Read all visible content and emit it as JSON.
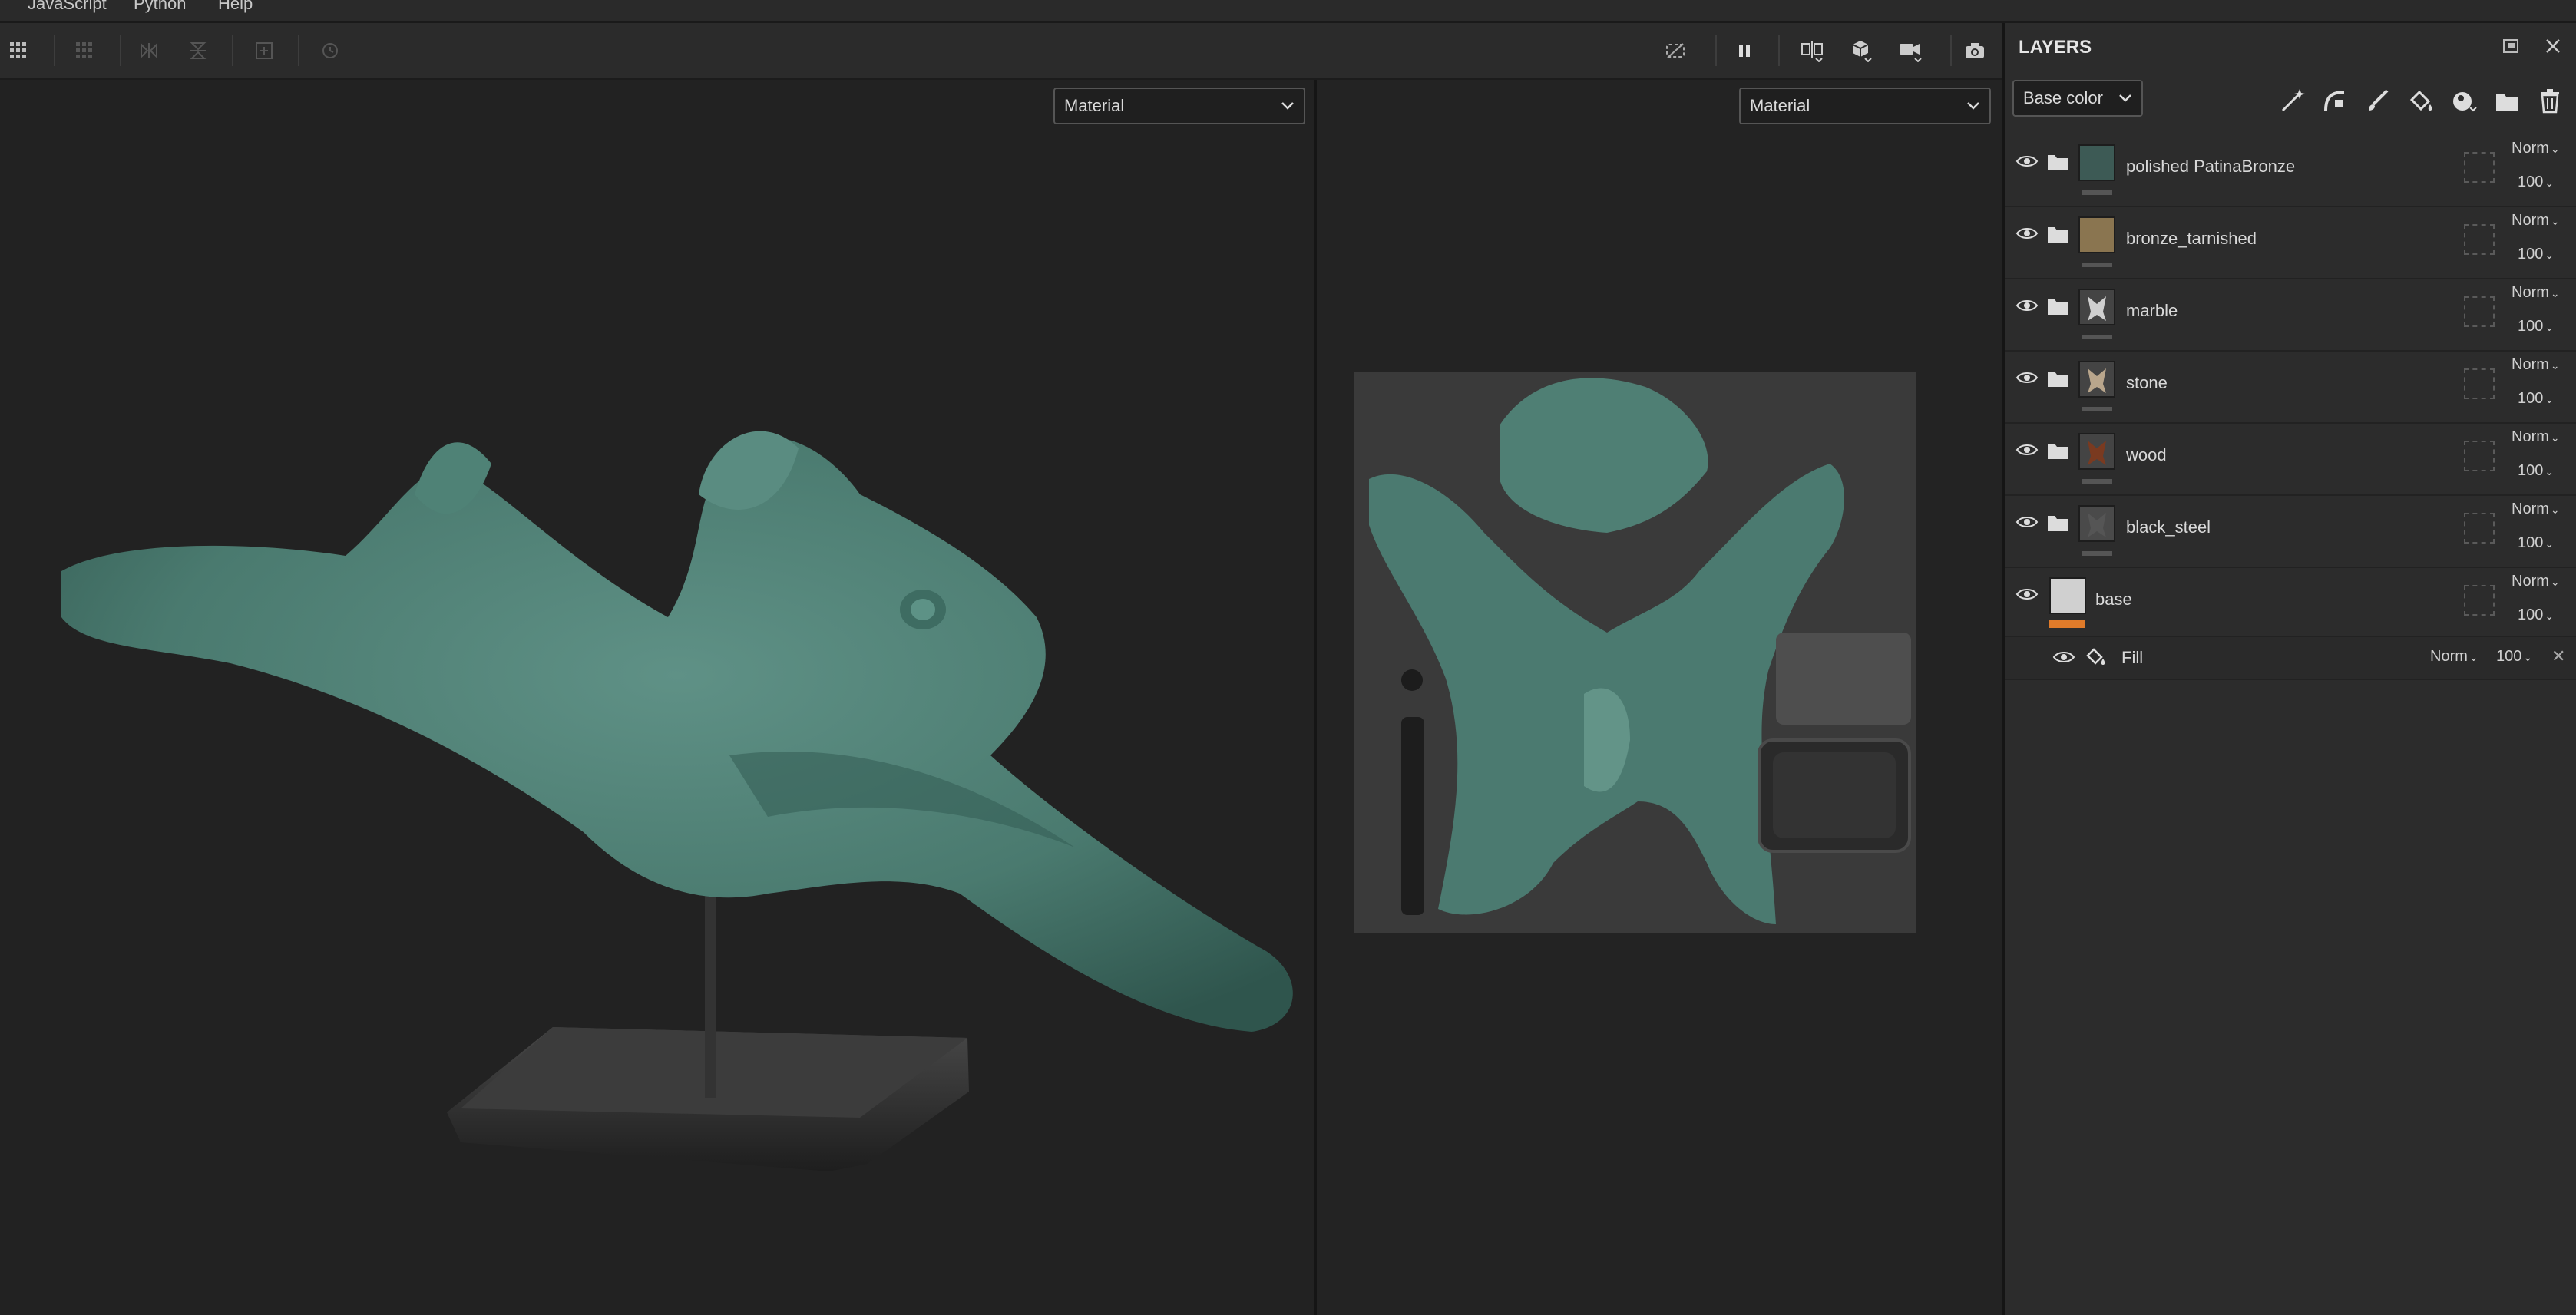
{
  "menubar": {
    "items": [
      "JavaScript",
      "Python",
      "Help"
    ]
  },
  "viewport_left": {
    "dropdown": "Material"
  },
  "viewport_right": {
    "dropdown": "Material"
  },
  "layers_panel": {
    "title": "LAYERS",
    "channel_dropdown": "Base color",
    "layers": [
      {
        "name": "polished PatinaBronze",
        "blend": "Norm",
        "opacity": "100",
        "thumb_color": "#3d5a55"
      },
      {
        "name": "bronze_tarnished",
        "blend": "Norm",
        "opacity": "100",
        "thumb_color": "#8a7550"
      },
      {
        "name": "marble",
        "blend": "Norm",
        "opacity": "100",
        "thumb_color": "#cfcfcf"
      },
      {
        "name": "stone",
        "blend": "Norm",
        "opacity": "100",
        "thumb_color": "#b9a68c"
      },
      {
        "name": "wood",
        "blend": "Norm",
        "opacity": "100",
        "thumb_color": "#7a3a20"
      },
      {
        "name": "black_steel",
        "blend": "Norm",
        "opacity": "100",
        "thumb_color": "#4a4a4a"
      },
      {
        "name": "base",
        "blend": "Norm",
        "opacity": "100",
        "thumb_color": "#d0d0d0"
      }
    ],
    "fill_effect": {
      "name": "Fill",
      "blend": "Norm",
      "opacity": "100"
    }
  },
  "colors": {
    "accent": "#e07b2a",
    "patina": "#4e8176",
    "panel": "#2c2c2c"
  }
}
